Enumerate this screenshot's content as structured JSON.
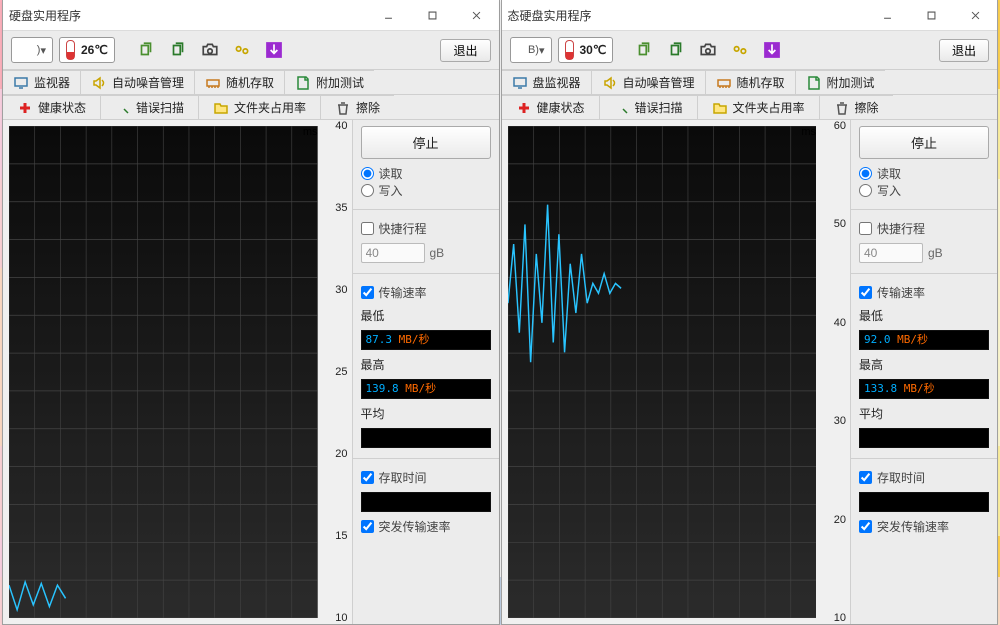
{
  "windows": [
    {
      "title": "硬盘实用程序",
      "drive": ")",
      "drive_chevron": "▾",
      "temp": "26℃",
      "toolbar_exit": "退出",
      "tabs1": [
        {
          "label": "监视器"
        },
        {
          "label": "自动噪音管理"
        },
        {
          "label": "随机存取"
        },
        {
          "label": "附加测试"
        }
      ],
      "tabs2": [
        {
          "label": "健康状态"
        },
        {
          "label": "错误扫描"
        },
        {
          "label": "文件夹占用率"
        },
        {
          "label": "擦除"
        }
      ],
      "panel": {
        "stop": "停止",
        "read": "读取",
        "write": "写入",
        "quick": "快捷行程",
        "quick_val": "40",
        "gB": "gB",
        "rate": "传输速率",
        "min": "最低",
        "min_v": "87.3",
        "min_u": "MB/秒",
        "max": "最高",
        "max_v": "139.8",
        "max_u": "MB/秒",
        "avg": "平均",
        "access": "存取时间",
        "burst": "突发传输速率"
      },
      "chart": {
        "ms": "ms",
        "ymin": 10,
        "ymax": 40,
        "ticks": [
          40,
          35,
          30,
          25,
          20,
          15,
          10
        ],
        "series": [
          12,
          10.5,
          12.2,
          10.8,
          12.1,
          10.7,
          12.0,
          11.2
        ]
      }
    },
    {
      "title": "态硬盘实用程序",
      "drive": "B)",
      "drive_chevron": "▾",
      "temp": "30℃",
      "toolbar_exit": "退出",
      "tabs1": [
        {
          "label": "盘监视器"
        },
        {
          "label": "自动噪音管理"
        },
        {
          "label": "随机存取"
        },
        {
          "label": "附加测试"
        }
      ],
      "tabs2": [
        {
          "label": "健康状态"
        },
        {
          "label": "错误扫描"
        },
        {
          "label": "文件夹占用率"
        },
        {
          "label": "擦除"
        }
      ],
      "panel": {
        "stop": "停止",
        "read": "读取",
        "write": "写入",
        "quick": "快捷行程",
        "quick_val": "40",
        "gB": "gB",
        "rate": "传输速率",
        "min": "最低",
        "min_v": "92.0",
        "min_u": "MB/秒",
        "max": "最高",
        "max_v": "133.8",
        "max_u": "MB/秒",
        "avg": "平均",
        "access": "存取时间",
        "burst": "突发传输速率"
      },
      "chart": {
        "ms": "ms",
        "ymin": 10,
        "ymax": 60,
        "ticks": [
          60,
          50,
          40,
          30,
          20,
          10
        ],
        "series": [
          42,
          48,
          39,
          50,
          36,
          47,
          40,
          52,
          38,
          49,
          37,
          46,
          41,
          47,
          42,
          44,
          43,
          45,
          43,
          44,
          43.5
        ]
      }
    }
  ],
  "chart_data": [
    {
      "type": "line",
      "title": "",
      "xlabel": "",
      "ylabel": "ms",
      "ylim": [
        10,
        40
      ],
      "values": [
        12,
        10.5,
        12.2,
        10.8,
        12.1,
        10.7,
        12.0,
        11.2
      ],
      "color": "#1fbcff"
    },
    {
      "type": "line",
      "title": "",
      "xlabel": "",
      "ylabel": "ms",
      "ylim": [
        10,
        60
      ],
      "values": [
        42,
        48,
        39,
        50,
        36,
        47,
        40,
        52,
        38,
        49,
        37,
        46,
        41,
        47,
        42,
        44,
        43,
        45,
        43,
        44,
        43.5
      ],
      "color": "#1fbcff"
    }
  ]
}
